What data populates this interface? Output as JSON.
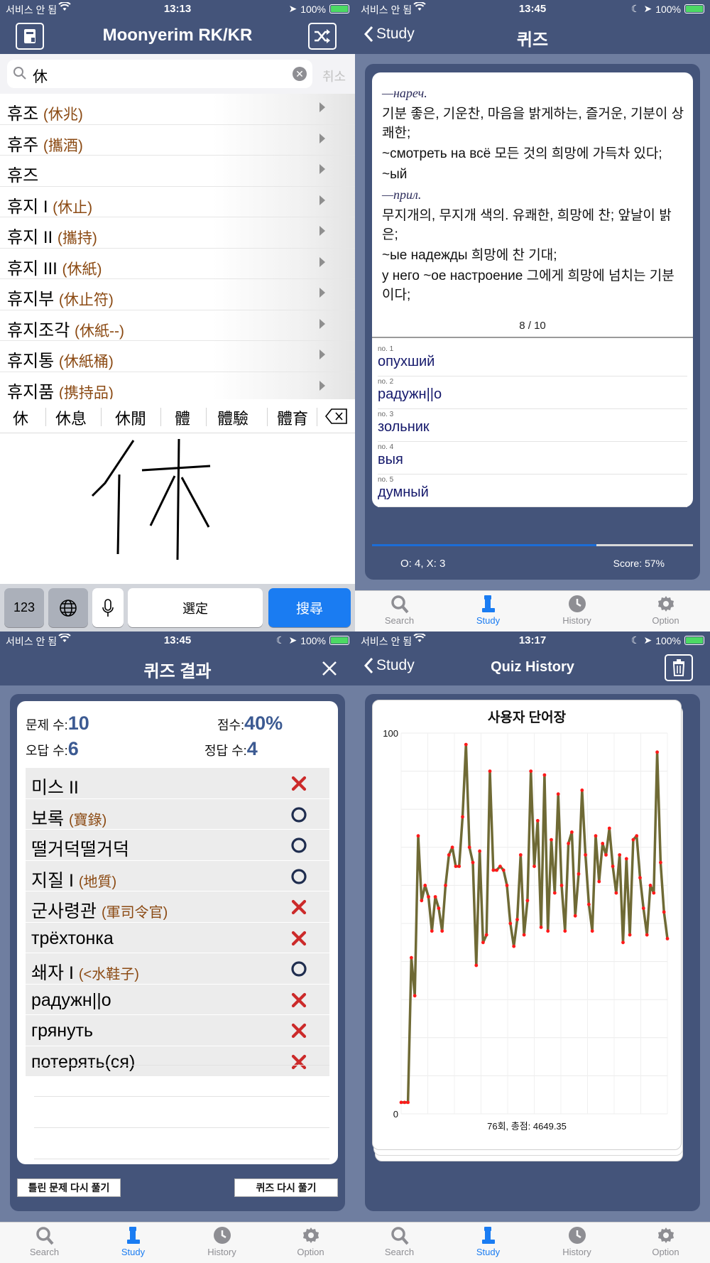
{
  "status": {
    "carrier": "서비스 안 됨",
    "battery": "100%",
    "times": [
      "13:13",
      "13:45",
      "13:45",
      "13:17"
    ]
  },
  "search_screen": {
    "title": "Moonyerim RK/KR",
    "search_value": "休",
    "cancel_label": "취소",
    "results": [
      {
        "word": "휴조",
        "hanja": "(休兆)"
      },
      {
        "word": "휴주",
        "hanja": "(攜酒)"
      },
      {
        "word": "휴즈",
        "hanja": ""
      },
      {
        "word": "휴지 I",
        "hanja": "(休止)"
      },
      {
        "word": "휴지 II",
        "hanja": "(攜持)"
      },
      {
        "word": "휴지 III",
        "hanja": "(休紙)"
      },
      {
        "word": "휴지부",
        "hanja": "(休止符)"
      },
      {
        "word": "휴지조각",
        "hanja": "(休紙--)"
      },
      {
        "word": "휴지통",
        "hanja": "(休紙桶)"
      },
      {
        "word": "휴지품",
        "hanja": "(携持品)"
      }
    ],
    "candidates": [
      "休",
      "休息",
      "休閒",
      "體",
      "體驗",
      "體育"
    ],
    "handwriting_char": "休",
    "keyboard": {
      "numbers": "123",
      "space": "選定",
      "search": "搜尋"
    }
  },
  "quiz_screen": {
    "back_label": "Study",
    "title": "퀴즈",
    "definition_lines": [
      {
        "text": "—нареч.",
        "italic": true
      },
      {
        "text": "기분 좋은, 기운찬, 마음을 밝게하는, 즐거운, 기분이 상쾌한;",
        "italic": false
      },
      {
        "text": "~смотреть на всё 모든 것의 희망에 가득차 있다;",
        "italic": false
      },
      {
        "text": "~ый",
        "italic": false
      },
      {
        "text": "—прил.",
        "italic": true
      },
      {
        "text": "무지개의, 무지개 색의. 유쾌한, 희망에 찬; 앞날이 밝은;",
        "italic": false
      },
      {
        "text": "~ые надежды 희망에 찬 기대;",
        "italic": false
      },
      {
        "text": "у него ~ое настроение 그에게 희망에 넘치는 기분이다;",
        "italic": false
      }
    ],
    "counter": "8 / 10",
    "progress": 0.7,
    "options": [
      {
        "no": "no. 1",
        "text": "опухший"
      },
      {
        "no": "no. 2",
        "text": "радужн||o"
      },
      {
        "no": "no. 3",
        "text": "зольник"
      },
      {
        "no": "no. 4",
        "text": "выя"
      },
      {
        "no": "no. 5",
        "text": "думный"
      }
    ],
    "tally": "O: 4, X: 3",
    "score": "Score: 57%"
  },
  "tabs": [
    {
      "label": "Search",
      "icon": "search-icon"
    },
    {
      "label": "Study",
      "icon": "study-icon"
    },
    {
      "label": "History",
      "icon": "history-icon"
    },
    {
      "label": "Option",
      "icon": "gear-icon"
    }
  ],
  "result_screen": {
    "title": "퀴즈 결과",
    "count_label": "문제 수:",
    "count_value": "10",
    "score_label": "점수:",
    "score_value": "40%",
    "wrong_label": "오답 수:",
    "wrong_value": "6",
    "right_label": "정답 수:",
    "right_value": "4",
    "rows": [
      {
        "word": "미스 II",
        "hanja": "",
        "correct": false
      },
      {
        "word": "보록",
        "hanja": "(寶錄)",
        "correct": true
      },
      {
        "word": "떨거덕떨거덕",
        "hanja": "",
        "correct": true
      },
      {
        "word": "지질 I",
        "hanja": "(地質)",
        "correct": true
      },
      {
        "word": "군사령관",
        "hanja": "(軍司令官)",
        "correct": false
      },
      {
        "word": "трёхтонка",
        "hanja": "",
        "correct": false
      },
      {
        "word": "쇄자 I",
        "hanja": "(<水鞋子)",
        "correct": true
      },
      {
        "word": "радужн||o",
        "hanja": "",
        "correct": false
      },
      {
        "word": "грянуть",
        "hanja": "",
        "correct": false
      },
      {
        "word": "потерять(ся)",
        "hanja": "",
        "correct": false
      }
    ],
    "retry_wrong_label": "틀린 문제 다시 풀기",
    "retry_quiz_label": "퀴즈 다시 풀기"
  },
  "history_screen": {
    "back_label": "Study",
    "title": "Quiz History",
    "summary": "76회, 총점: 4649.35"
  },
  "chart_data": {
    "type": "line",
    "title": "사용자 단어장",
    "ylim": [
      0,
      100
    ],
    "ytick_labels": [
      "100",
      "0"
    ],
    "grid": true,
    "line_color": "#6f6a35",
    "point_color": "#ff1a1a",
    "values": [
      3,
      3,
      3,
      41,
      31,
      73,
      56,
      60,
      57,
      48,
      57,
      54,
      48,
      60,
      68,
      70,
      65,
      65,
      78,
      97,
      70,
      66,
      39,
      69,
      45,
      47,
      90,
      64,
      64,
      65,
      64,
      60,
      50,
      44,
      51,
      68,
      47,
      56,
      90,
      65,
      77,
      49,
      89,
      48,
      72,
      58,
      84,
      60,
      48,
      71,
      74,
      52,
      63,
      85,
      68,
      55,
      48,
      73,
      61,
      71,
      68,
      75,
      65,
      58,
      68,
      45,
      67,
      47,
      72,
      73,
      62,
      54,
      47,
      60,
      58,
      95,
      66,
      53,
      46
    ]
  }
}
